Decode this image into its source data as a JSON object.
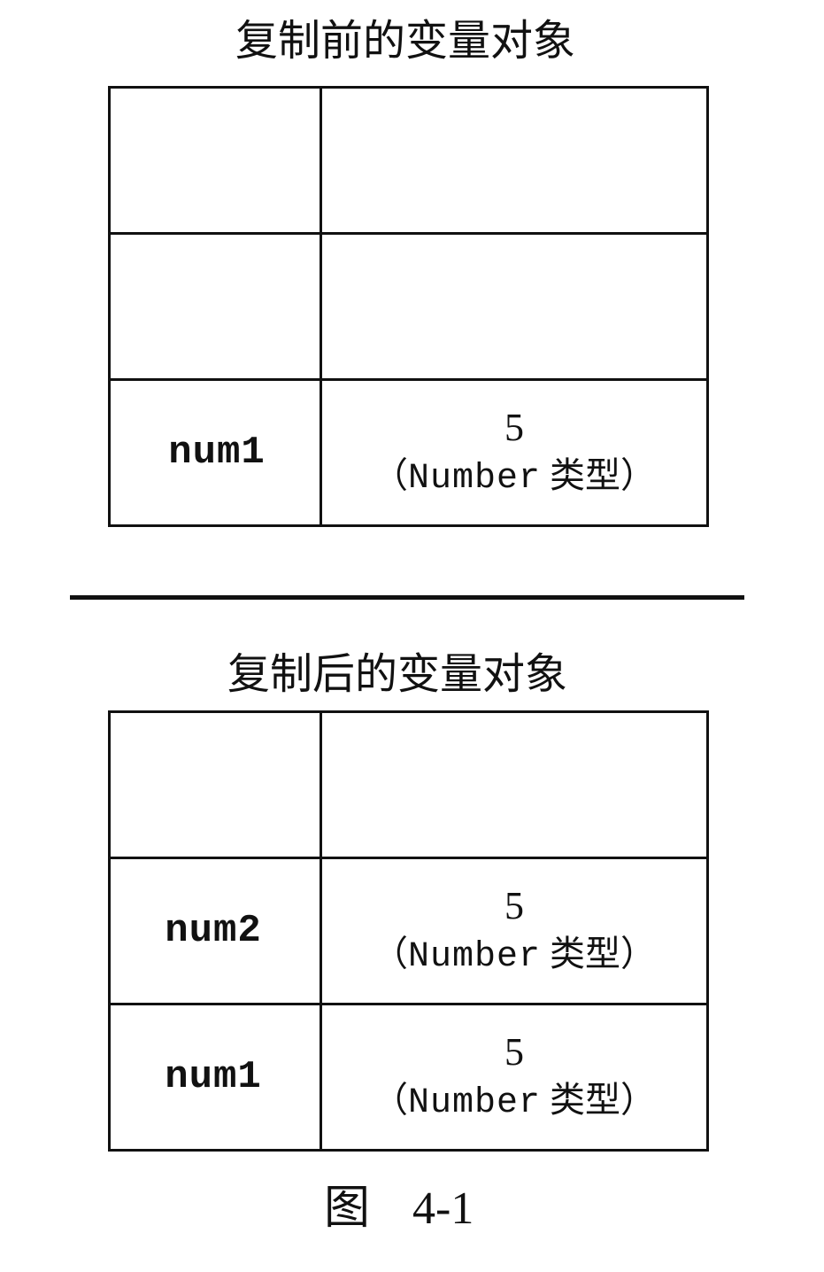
{
  "before": {
    "title": "复制前的变量对象",
    "rows": [
      {
        "name": "",
        "value": "",
        "type_open": "",
        "type_word": "",
        "type_cn": "",
        "type_close": ""
      },
      {
        "name": "",
        "value": "",
        "type_open": "",
        "type_word": "",
        "type_cn": "",
        "type_close": ""
      },
      {
        "name": "num1",
        "value": "5",
        "type_open": "（",
        "type_word": "Number",
        "type_cn": "类型",
        "type_close": "）"
      }
    ]
  },
  "after": {
    "title": "复制后的变量对象",
    "rows": [
      {
        "name": "",
        "value": "",
        "type_open": "",
        "type_word": "",
        "type_cn": "",
        "type_close": ""
      },
      {
        "name": "num2",
        "value": "5",
        "type_open": "（",
        "type_word": "Number",
        "type_cn": "类型",
        "type_close": "）"
      },
      {
        "name": "num1",
        "value": "5",
        "type_open": "（",
        "type_word": "Number",
        "type_cn": "类型",
        "type_close": "）"
      }
    ]
  },
  "caption": {
    "label": "图",
    "number": "4-1"
  }
}
